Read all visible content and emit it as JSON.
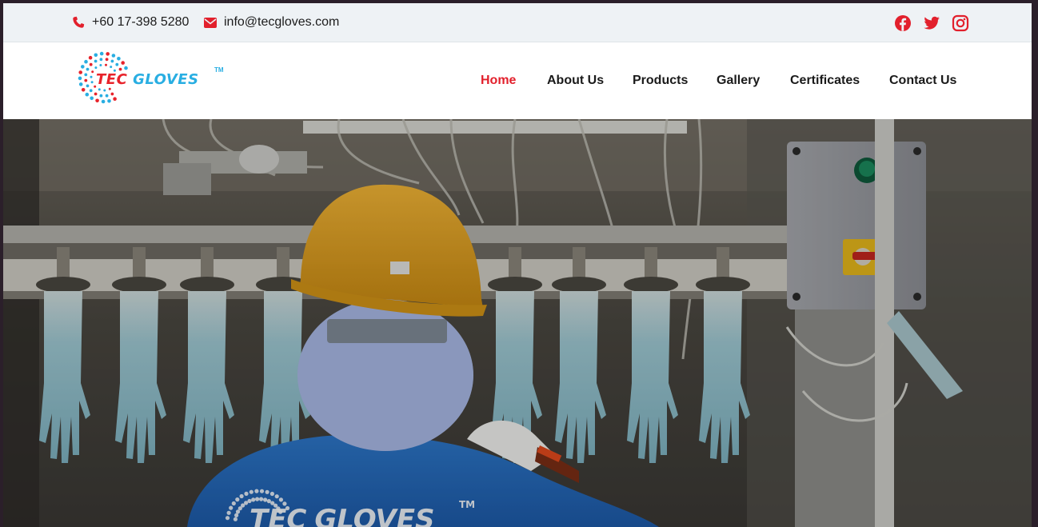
{
  "topbar": {
    "phone": "+60 17-398 5280",
    "email": "info@tecgloves.com",
    "phone_icon": "phone-icon",
    "email_icon": "envelope-icon",
    "social": [
      "facebook-icon",
      "twitter-icon",
      "instagram-icon"
    ]
  },
  "brand": {
    "logo_tec": "TEC",
    "logo_gloves": "GLOVES",
    "logo_tm": "TM",
    "colors": {
      "red": "#e8232b",
      "blue": "#29aee2"
    }
  },
  "nav": {
    "items": [
      "Home",
      "About Us",
      "Products",
      "Gallery",
      "Certificates",
      "Contact Us"
    ],
    "active": "Home",
    "active_color": "#e2202c"
  },
  "hero": {
    "shirt_logo_tec": "TEC",
    "shirt_logo_gloves": "GLOVES",
    "shirt_logo_tm": "TM"
  }
}
